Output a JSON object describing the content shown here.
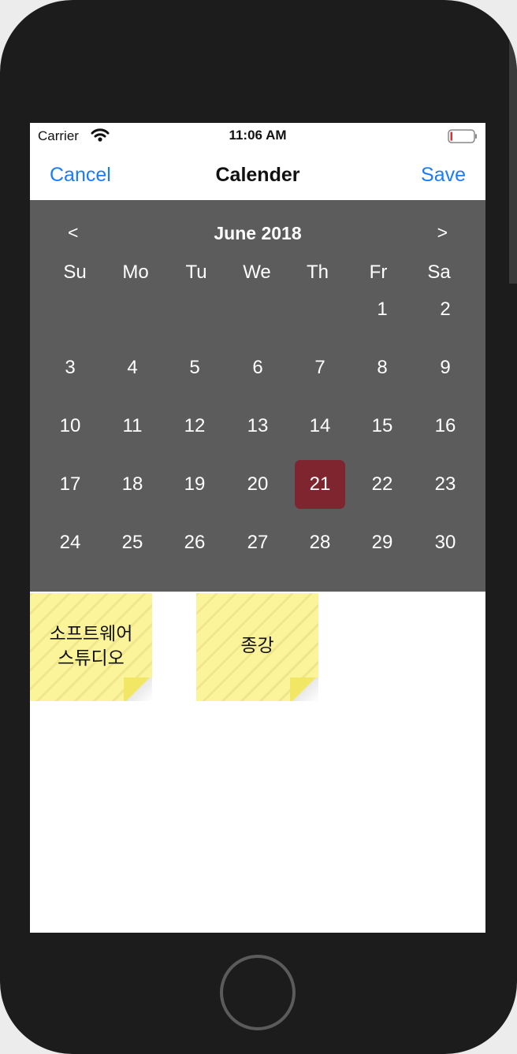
{
  "status_bar": {
    "carrier": "Carrier",
    "time": "11:06 AM"
  },
  "nav": {
    "cancel_label": "Cancel",
    "title": "Calender",
    "save_label": "Save"
  },
  "calendar": {
    "prev_label": "<",
    "next_label": ">",
    "month_label": "June 2018",
    "weekdays": [
      "Su",
      "Mo",
      "Tu",
      "We",
      "Th",
      "Fr",
      "Sa"
    ],
    "days": [
      "1",
      "2",
      "3",
      "4",
      "5",
      "6",
      "7",
      "8",
      "9",
      "10",
      "11",
      "12",
      "13",
      "14",
      "15",
      "16",
      "17",
      "18",
      "19",
      "20",
      "21",
      "22",
      "23",
      "24",
      "25",
      "26",
      "27",
      "28",
      "29",
      "30"
    ],
    "selected_day": "21"
  },
  "notes": [
    {
      "line1": "소프트웨어",
      "line2": "스튜디오"
    },
    {
      "line1": "종강",
      "line2": ""
    }
  ],
  "colors": {
    "accent": "#1c7cf5",
    "calendar_bg": "#5c5c5c",
    "selected_day_bg": "#7e2530",
    "note_bg": "#fcf49b"
  }
}
